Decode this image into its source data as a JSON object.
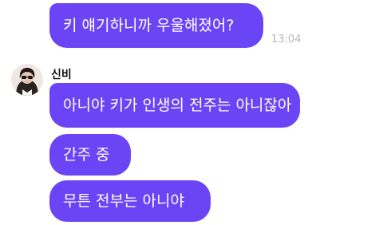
{
  "chat": {
    "sent_message": {
      "text": "키 얘기하니까 우울해졌어?",
      "time": "13:04"
    },
    "sender": {
      "name": "신비"
    },
    "received_messages": [
      {
        "text": "아니야 키가 인생의 전주는 아니잖아"
      },
      {
        "text": "간주 중"
      },
      {
        "text": "무튼 전부는 아니야"
      }
    ],
    "colors": {
      "bubble": "#6b45f5",
      "bubble_text": "#ffffff",
      "timestamp": "#b7b7b7"
    },
    "icons": {
      "avatar": "profile-photo-avatar"
    }
  }
}
